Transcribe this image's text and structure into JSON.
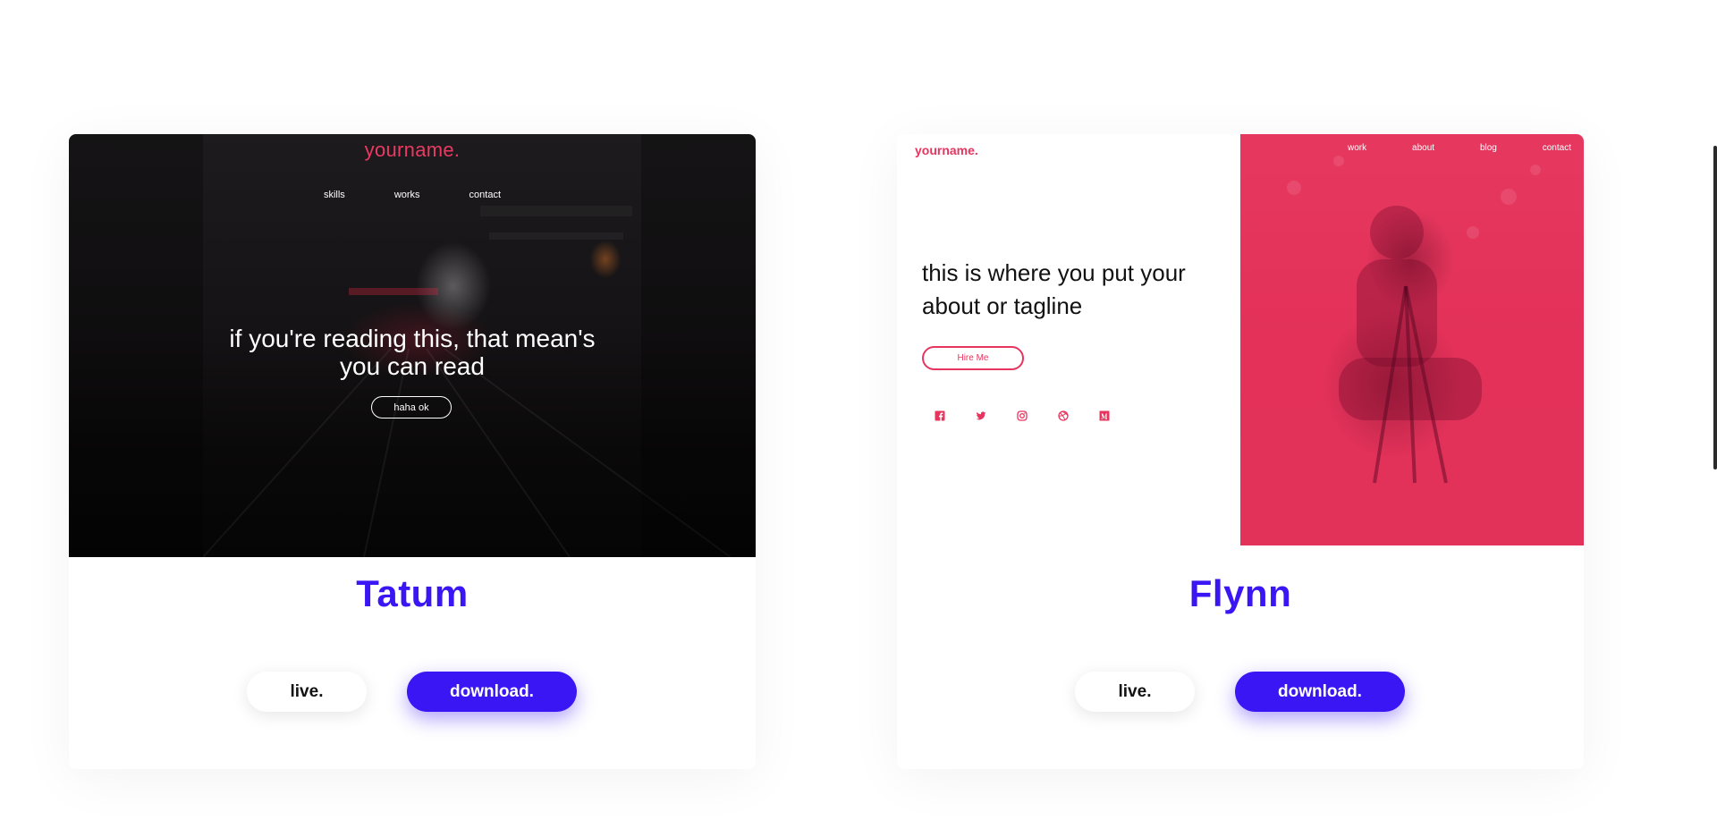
{
  "colors": {
    "accent_blue": "#3a16f5",
    "accent_pink": "#e8355f",
    "dark_bg": "#111011",
    "page_bg": "#ffffff"
  },
  "templates": [
    {
      "name": "Tatum",
      "preview": {
        "logo": "yourname.",
        "nav": [
          "skills",
          "works",
          "contact"
        ],
        "hero_line1": "if you're reading this, that mean's",
        "hero_line2": "you can read",
        "button": "haha ok"
      },
      "live_label": "live.",
      "download_label": "download."
    },
    {
      "name": "Flynn",
      "preview": {
        "logo": "yourname.",
        "nav": [
          "work",
          "about",
          "blog",
          "contact"
        ],
        "hero_line1": "this is where you put your",
        "hero_line2": "about or tagline",
        "button": "Hire Me",
        "socials": [
          "facebook-icon",
          "twitter-icon",
          "instagram-icon",
          "dribbble-icon",
          "medium-icon"
        ]
      },
      "live_label": "live.",
      "download_label": "download."
    }
  ]
}
